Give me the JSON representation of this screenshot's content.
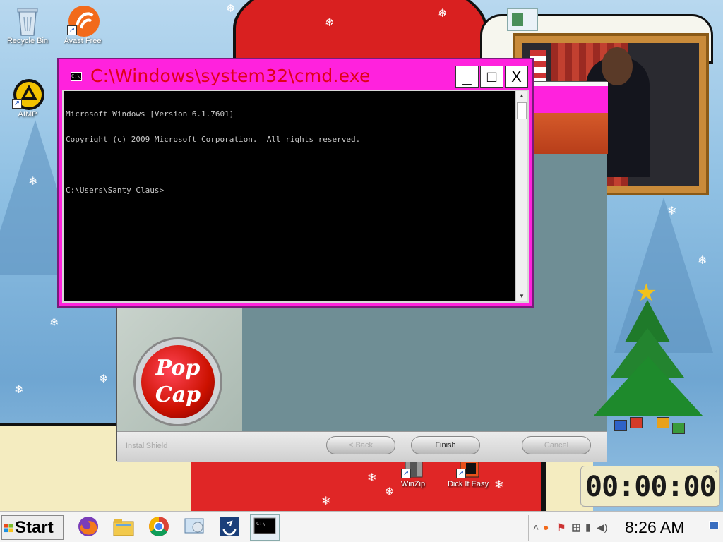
{
  "desktop": {
    "icons": [
      {
        "label": "Recycle Bin"
      },
      {
        "label": "Avast Free"
      },
      {
        "label": "AIMP"
      },
      {
        "label": "WinZip"
      },
      {
        "label": "Dick It Easy"
      }
    ]
  },
  "cmd_window": {
    "title": "C:\\Windows\\system32\\cmd.exe",
    "console_lines": [
      "Microsoft Windows [Version 6.1.7601]",
      "Copyright (c) 2009 Microsoft Corporation.  All rights reserved.",
      "",
      "C:\\Users\\Santy Claus>"
    ],
    "icon_text": "C:\\_",
    "buttons": {
      "minimize": "_",
      "maximize": "□",
      "close": "X"
    }
  },
  "installer": {
    "brand_line1": "Pop",
    "brand_line2": "Cap",
    "footer_label": "InstallShield",
    "back_label": "< Back",
    "finish_label": "Finish",
    "cancel_label": "Cancel"
  },
  "timer": {
    "display": "00:00:00"
  },
  "taskbar": {
    "start_label": "Start",
    "clock": "8:26 AM",
    "apps": [
      "firefox-icon",
      "file-explorer-icon",
      "chrome-icon",
      "control-panel-icon",
      "sync-icon",
      "cmd-icon"
    ]
  },
  "colors": {
    "cmd_title_bg": "#ff22dd",
    "cmd_title_text": "#e0001a",
    "console_bg": "#000000",
    "console_text": "#c8c8c8"
  }
}
